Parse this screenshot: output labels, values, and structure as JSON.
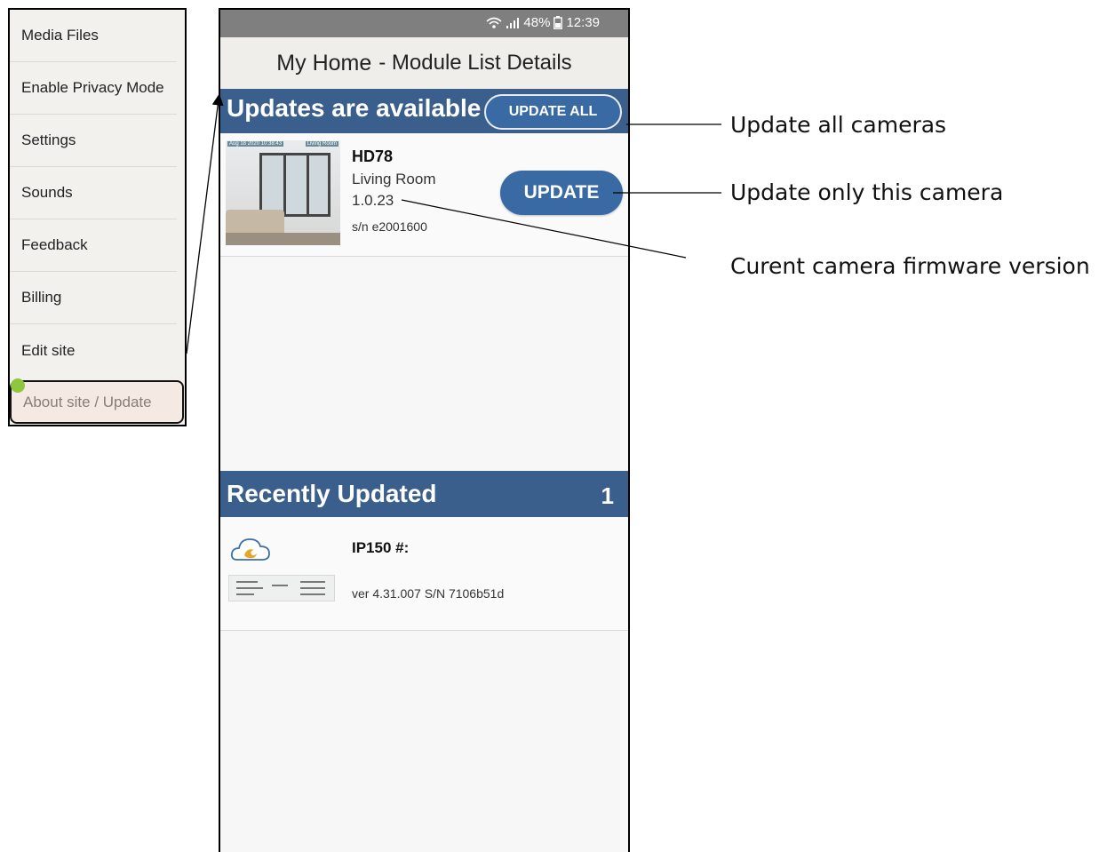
{
  "menu": {
    "items": [
      {
        "label": "Media Files"
      },
      {
        "label": "Enable Privacy Mode"
      },
      {
        "label": "Settings"
      },
      {
        "label": "Sounds"
      },
      {
        "label": "Feedback"
      },
      {
        "label": "Billing"
      },
      {
        "label": "Edit site"
      },
      {
        "label": "About site / Update",
        "active": true
      }
    ]
  },
  "status_bar": {
    "battery": "48%",
    "time": "12:39"
  },
  "app_bar": {
    "site_name": "My Home",
    "title": "- Module List Details"
  },
  "updates_section": {
    "title": "Updates are available",
    "update_all_label": "UPDATE ALL",
    "camera": {
      "name": "HD78",
      "room": "Living Room",
      "firmware": "1.0.23",
      "serial": "s/n e2001600",
      "thumb_timestamp": "Aug 18 2020 10:38:43",
      "thumb_label": "Living Room",
      "update_label": "UPDATE"
    }
  },
  "recent_section": {
    "title": "Recently Updated",
    "count": "1",
    "device": {
      "name": "IP150 #:",
      "version": "ver 4.31.007 S/N 7106b51d"
    }
  },
  "annotations": {
    "update_all": "Update all cameras",
    "update_one": "Update only this camera",
    "firmware": "Curent camera firmware version"
  },
  "colors": {
    "section_bar": "#3a5f8c",
    "button": "#3a6aa3",
    "menu_active_dot": "#8fc63e"
  }
}
